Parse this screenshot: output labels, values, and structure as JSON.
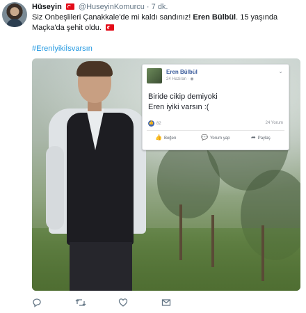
{
  "tweet": {
    "author_name": "Hüseyin",
    "handle": "@HuseyinKomurcu",
    "time": "· 7 dk.",
    "text_part1": "Siz Onbeşlileri Çanakkale'de mi kaldı sandınız! ",
    "text_bold": "Eren Bülbül",
    "text_part2": ". 15 yaşında Maçka'da şehit oldu.",
    "hashtag": "#Erenİyikiİsvarsın"
  },
  "facebook_post": {
    "name": "Eren Bülbül",
    "date": "24 Haziran · ",
    "line1": "Biride cikip demiyoki",
    "line2": "Eren iyiki varsın :(",
    "likes": "82",
    "comments": "24 Yorum",
    "actions": [
      "Beğen",
      "Yorum yap",
      "Paylaş"
    ],
    "like_icon": "thumbs-up-icon",
    "comment_icon": "comment-icon",
    "share_icon": "share-arrow-icon"
  },
  "icons": {
    "reply": "reply-icon",
    "retweet": "retweet-icon",
    "like": "heart-icon",
    "dm": "envelope-icon"
  },
  "colors": {
    "link": "#1b95e0",
    "flag_red": "#e30a17",
    "fb_blue": "#365899"
  }
}
